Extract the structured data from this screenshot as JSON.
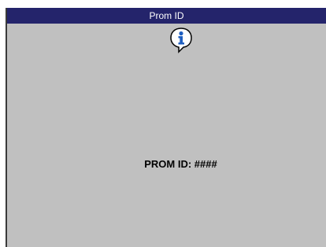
{
  "dialog": {
    "title": "Prom ID",
    "icon": "info-icon",
    "message": "PROM ID: ####"
  },
  "colors": {
    "title_bar": "#24246b",
    "title_text": "#ffffff",
    "background": "#c0c0c0",
    "icon_blue": "#1f5fc0"
  }
}
